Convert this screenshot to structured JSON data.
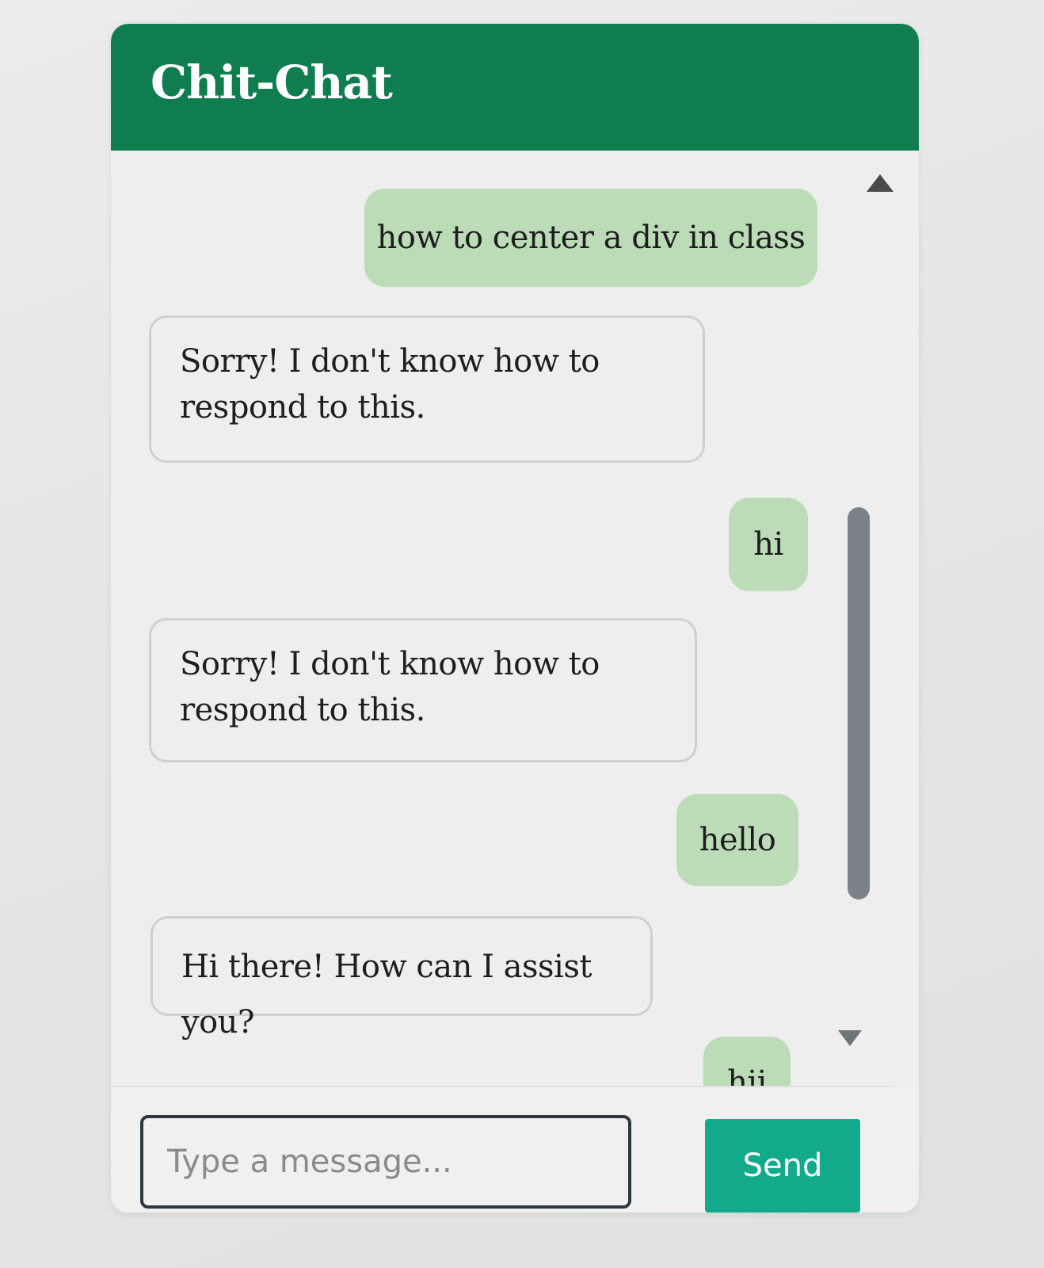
{
  "app": {
    "title": "Chit-Chat"
  },
  "messages": [
    {
      "sender": "user",
      "text": "how to center a div in class"
    },
    {
      "sender": "bot",
      "text": "Sorry! I don't know how to respond to this."
    },
    {
      "sender": "user",
      "text": "hi"
    },
    {
      "sender": "bot",
      "text": "Sorry! I don't know how to respond to this."
    },
    {
      "sender": "user",
      "text": "hello"
    },
    {
      "sender": "bot",
      "text": "Hi there! How can I assist you?"
    },
    {
      "sender": "user",
      "text": "hii"
    }
  ],
  "composer": {
    "placeholder": "Type a message...",
    "value": "",
    "send_label": "Send"
  },
  "colors": {
    "header": "#107d50",
    "user_bubble": "#bcdcb8",
    "bot_bubble_border": "#cfcfcf",
    "send_button": "#13aa8c"
  },
  "icons": {
    "scroll_up": "triangle-up-icon",
    "scroll_down": "triangle-down-icon"
  }
}
